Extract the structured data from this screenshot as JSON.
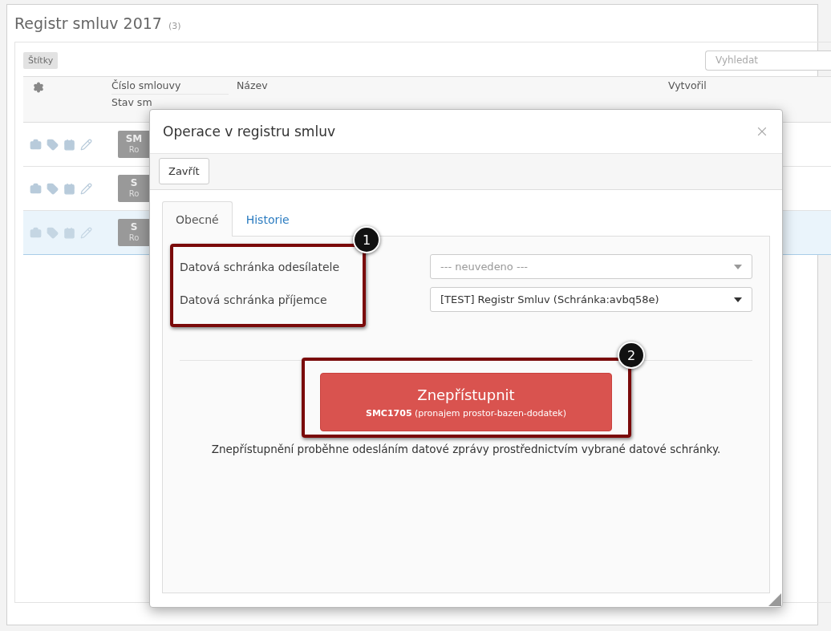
{
  "page": {
    "title": "Registr smluv 2017",
    "count": "(3)"
  },
  "toolbar": {
    "tags_button": {
      "label": "Štítky",
      "disabled": true
    },
    "search": {
      "placeholder": "Vyhledat"
    }
  },
  "table": {
    "columns": [
      {
        "label": "Číslo smlouvy",
        "sub": "Stav sm"
      },
      {
        "label": "Název"
      },
      {
        "label": "Vytvořil"
      }
    ],
    "rows": [
      {
        "number": "SM",
        "type": "Ro",
        "selected": false
      },
      {
        "number": "S",
        "type": "Ro",
        "selected": false
      },
      {
        "number": "S",
        "type": "Ro",
        "selected": true
      }
    ]
  },
  "dialog": {
    "title": "Operace v registru smluv",
    "toolbar_buttons": [
      "Zavřít"
    ],
    "tabs": [
      {
        "label": "Obecné",
        "selected": true
      },
      {
        "label": "Historie",
        "selected": false
      }
    ],
    "fields": [
      {
        "label": "Datová schránka odesílatele",
        "value": "--- neuvedeno ---",
        "disabled": true
      },
      {
        "label": "Datová schránka příjemce",
        "value": "[TEST] Registr Smluv (Schránka:avbq58e)",
        "disabled": false
      }
    ],
    "action": {
      "label": "Znepřístupnit",
      "detail": "**SMC1705** (pronajem prostor-bazen-dodatek)"
    },
    "note": "Znepřístupnění proběhne odesláním datové zprávy prostřednictvím vybrané datové schránky.",
    "callouts": [
      {
        "number": "1"
      },
      {
        "number": "2"
      }
    ]
  }
}
